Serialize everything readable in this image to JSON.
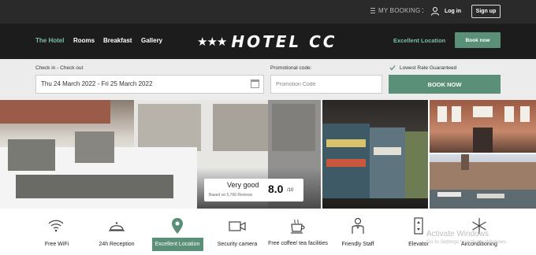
{
  "topbar": {
    "my_booking": "MY BOOKING",
    "separator": ":",
    "login": "Log in",
    "signup": "Sign up"
  },
  "nav": {
    "items": [
      "The Hotel",
      "Rooms",
      "Breakfast",
      "Gallery"
    ],
    "active": "The Hotel",
    "logo_stars": "★★★",
    "logo_text": "HOTEL CC",
    "excellent_location": "Excellent Location",
    "book_now": "Book now"
  },
  "booking": {
    "dates_label": "Check in - Check out",
    "dates_value": "Thu 24 March 2022 - Fri 25 March 2022",
    "promo_label": "Promotional code:",
    "promo_placeholder": "Promotion Code",
    "guarantee": "Lowest Rate Guaranteed",
    "book_button": "BOOK NOW"
  },
  "rating": {
    "word": "Very good",
    "based_on": "Based on 5,766 Reviews",
    "score": "8.0",
    "scale": "/10"
  },
  "amenities": [
    {
      "label": "Free WiFi",
      "icon": "wifi-icon"
    },
    {
      "label": "24h Reception",
      "icon": "bell-icon"
    },
    {
      "label": "Excellent Location",
      "icon": "location-pin-icon"
    },
    {
      "label": "Security camera",
      "icon": "camera-icon"
    },
    {
      "label": "Free coffee/ tea facilities",
      "icon": "coffee-cup-icon"
    },
    {
      "label": "Friendly Staff",
      "icon": "staff-icon"
    },
    {
      "label": "Elevator",
      "icon": "elevator-icon"
    },
    {
      "label": "Airconditioning",
      "icon": "snowflake-icon"
    }
  ],
  "watermark": {
    "title": "Activate Windows",
    "subtitle": "Go to Settings to activate Windows."
  },
  "colors": {
    "accent": "#5a8f78",
    "accent_text": "#7bbfa4",
    "dark": "#1c1c1c"
  }
}
